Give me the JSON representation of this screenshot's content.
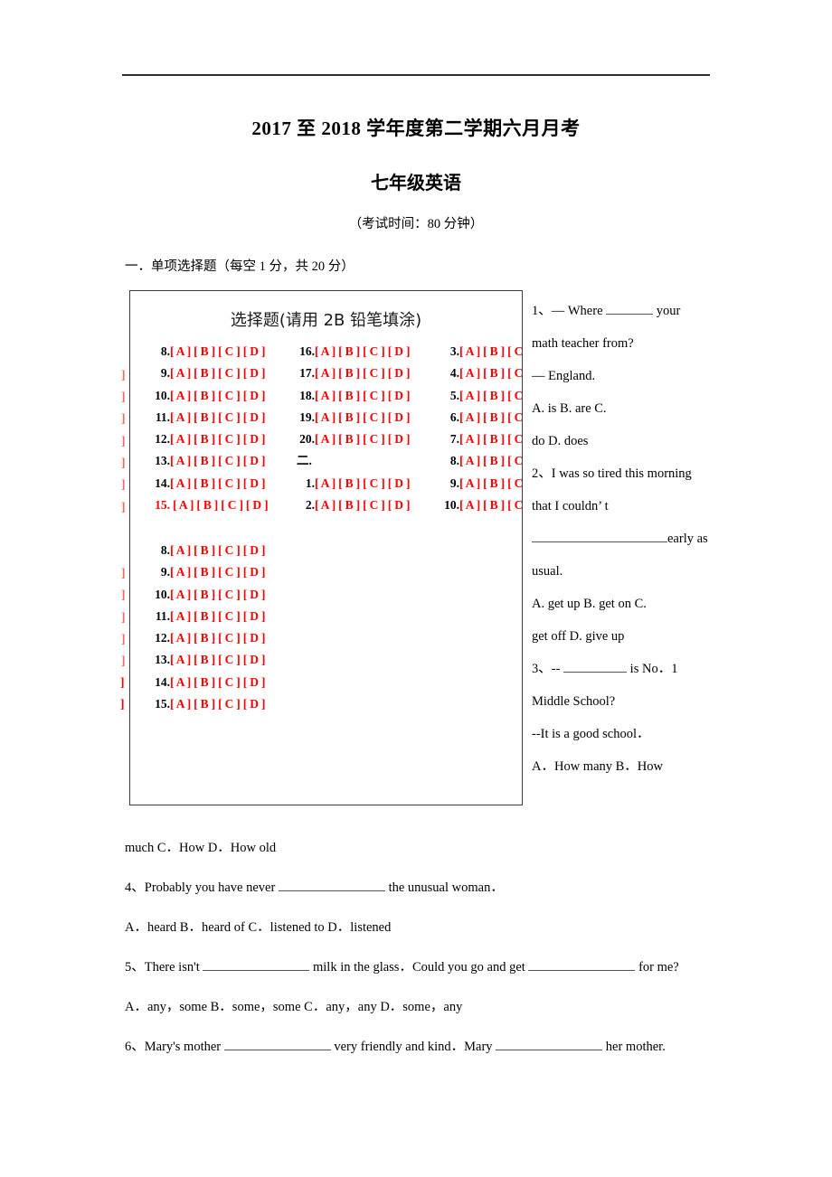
{
  "document": {
    "title": "2017 至 2018 学年度第二学期六月月考",
    "subtitle": "七年级英语",
    "meta": "（考试时间：80 分钟）",
    "section_heading": "一．单项选择题（每空 1 分，共 20 分）"
  },
  "answer_sheet": {
    "title": "选择题(请用 2B 铅笔填涂)",
    "options_text": "[ A ] [ B ] [ C ] [ D ]",
    "options_clipped": "[ A ] [ B ] [ C ]",
    "section_two_mark": "二.",
    "column_1": [
      {
        "num": "8.",
        "opts": "[ A ] [ B ] [ C ] [ D ]"
      },
      {
        "num": "9.",
        "opts": "[ A ] [ B ] [ C ] [ D ]"
      },
      {
        "num": "10.",
        "opts": "[ A ] [ B ] [ C ] [ D ]"
      },
      {
        "num": "11.",
        "opts": "[ A ] [ B ] [ C ] [ D ]"
      },
      {
        "num": "12.",
        "opts": "[ A ] [ B ] [ C ] [ D ]"
      },
      {
        "num": "13.",
        "opts": "[ A ] [ B ] [ C ] [ D ]"
      },
      {
        "num": "14.",
        "opts": "[ A ] [ B ] [ C ] [ D ]"
      },
      {
        "num": "15.",
        "opts": " [ A ] [ B ] [ C ] [ D ]"
      }
    ],
    "column_2": [
      {
        "num": "16.",
        "opts": "[ A ] [ B ] [ C ] [ D ]"
      },
      {
        "num": "17.",
        "opts": "[ A ] [ B ] [ C ] [ D ]"
      },
      {
        "num": "18.",
        "opts": "[ A ] [ B ] [ C ] [ D ]"
      },
      {
        "num": "19.",
        "opts": "[ A ] [ B ] [ C ] [ D ]"
      },
      {
        "num": "20.",
        "opts": "[ A ] [ B ] [ C ] [ D ]"
      },
      {
        "num": "二.",
        "opts": ""
      },
      {
        "num": "1.",
        "opts": "[ A ] [ B ] [ C ] [ D ]"
      },
      {
        "num": "2.",
        "opts": "[ A ] [ B ] [ C ] [ D ]"
      }
    ],
    "column_3": [
      {
        "num": "3.",
        "opts": "[ A ] [ B ] [ C ]"
      },
      {
        "num": "4.",
        "opts": "[ A ] [ B ] [ C ]"
      },
      {
        "num": "5.",
        "opts": "[ A ] [ B ] [ C ]"
      },
      {
        "num": "6.",
        "opts": "[ A ] [ B ] [ C ]"
      },
      {
        "num": "7.",
        "opts": "[ A ] [ B ] [ C ]"
      },
      {
        "num": "8.",
        "opts": "[ A ] [ B ] [ C ]"
      },
      {
        "num": "9.",
        "opts": "[ A ] [ B ] [ C ]"
      },
      {
        "num": "10.",
        "opts": "[ A ] [ B ] [ C"
      }
    ],
    "block_2": [
      {
        "num": "8.",
        "opts": "[ A ] [ B ] [ C ] [ D ]"
      },
      {
        "num": "9.",
        "opts": "[ A ] [ B ] [ C ] [ D ]"
      },
      {
        "num": "10.",
        "opts": "[ A ] [ B ] [ C ] [ D ]"
      },
      {
        "num": "11.",
        "opts": "[ A ] [ B ] [ C ] [ D ]"
      },
      {
        "num": "12.",
        "opts": "[ A ] [ B ] [ C ] [ D ]"
      },
      {
        "num": "13.",
        "opts": "[ A ] [ B ] [ C ] [ D ]"
      },
      {
        "num": "14.",
        "opts": "[ A ] [ B ] [ C ] [ D ]"
      },
      {
        "num": "15.",
        "opts": "[ A ] [ B ] [ C ] [ D ]"
      }
    ],
    "edge_fragments": [
      "]",
      "]",
      "]",
      "]",
      "]",
      "]",
      "]",
      "]",
      "]",
      "]",
      "]",
      "]",
      "]",
      "]"
    ]
  },
  "questions_column": {
    "q1": {
      "line1_pre": "1、— Where",
      "line1_post": "your",
      "line2": "math teacher from?",
      "line3": "— England.",
      "line4": "A. is        B. are        C.",
      "line5": "do        D. does"
    },
    "q2": {
      "line1": "2、I was so tired this morning",
      "line2": "that I couldn’ t",
      "line3_post": "early as",
      "line4": "usual.",
      "line5": "A. get up    B. get on    C.",
      "line6": "get off      D. give up"
    },
    "q3": {
      "line1_pre": "3、--",
      "line1_post": "is No．1",
      "line2": "Middle School?",
      "line3": "--It is a good school．",
      "line4": "A．How many   B．How"
    }
  },
  "questions_full": {
    "q3_cont": "much     C．How        D．How old",
    "q4": {
      "pre": "4、Probably you have never",
      "post": "the unusual woman．",
      "options": "A．heard       B．heard of    C．listened to    D．listened"
    },
    "q5": {
      "pre": "5、There isn't",
      "mid": "milk in the glass．Could you go and get",
      "post": "for me?",
      "options": "A．any，some     B．some，some   C．any，any      D．some，any"
    },
    "q6": {
      "pre": "6、Mary's mother",
      "mid": "very friendly and kind．Mary",
      "post": "her mother."
    }
  }
}
